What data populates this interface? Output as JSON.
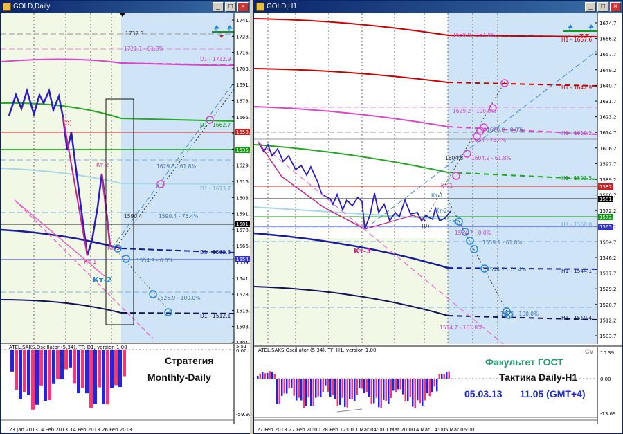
{
  "left_window": {
    "title": "GOLD,Daily",
    "buttons": {
      "minimize": "_",
      "maximize": "□",
      "close": "×"
    },
    "price_axis": [
      "1741.2",
      "1728.7",
      "1716.2",
      "1703.7",
      "1691.2",
      "1678.7",
      "1666.2",
      "1653.7",
      "1641.2",
      "1629.6",
      "1616.2",
      "1603.7",
      "1591.2",
      "1578.7",
      "1566.2",
      "1554.9",
      "1541.2",
      "1528.7",
      "1516.2",
      "1503.7",
      "1491.2"
    ],
    "price_tags": {
      "red": "1653.5",
      "green": "1635.3",
      "black": "1581.5",
      "blue": "1554.9"
    },
    "labels": {
      "lbl_1732": "1732.3",
      "lbl_1721": "1721.1 - 61.8%",
      "lbl_d1_1712": "D1 - 1712.9",
      "lbl_d1_1662": "D1 - 1662.7",
      "lbl_1629": "1629.6 - 61.8%",
      "lbl_d1_1613": "D1 - 1613.7",
      "lbl_1590": "1590.4",
      "lbl_1590_76": "1590.4 - 76.4%",
      "lbl_d1_1562": "D1 - 1562.3",
      "lbl_1554": "1554.9 - 0.0%",
      "lbl_1526": "1526.9 - 100.0%",
      "lbl_d1_1512": "D1 - 1512.1",
      "lbl_zero": "(0)",
      "lbl_kt2_top": "Кт-2",
      "lbl_kt1": "Кт-1",
      "lbl_kt3": "Кт-3",
      "lbl_kt2_blue": "Кт-2"
    },
    "osc_title": "ATEL.SAKS.Oscillator (5,34), TF: D1, version 1.00",
    "osc_axis": [
      "5.51",
      "0.00",
      "-59.93"
    ],
    "caption": [
      "Стратегия",
      "Monthly-Daily"
    ],
    "time_axis": [
      "23 Jan 2013",
      "4 Feb 2013",
      "14 Feb 2013",
      "26 Feb 2013"
    ]
  },
  "right_window": {
    "title": "GOLD,H1",
    "buttons": {
      "minimize": "_",
      "maximize": "□",
      "close": "×"
    },
    "price_axis": [
      "1674.7",
      "1666.2",
      "1657.7",
      "1649.2",
      "1640.7",
      "1631.7",
      "1623.2",
      "1614.7",
      "1606.2",
      "1597.7",
      "1589.2",
      "1580.7",
      "1572.2",
      "1563.2",
      "1554.7",
      "1546.2",
      "1537.7",
      "1529.2",
      "1520.7",
      "1512.2",
      "1503.7"
    ],
    "price_tags": {
      "red": "1587.2",
      "black": "1581.5",
      "green": "1572.6",
      "blue": "1565.6"
    },
    "labels": {
      "lbl_1668": "1668.9 - 161.8%",
      "lbl_h1_1667": "H1 - 1667.6",
      "lbl_h1_1642": "H1 - 1642.9",
      "lbl_1629": "1629.2 - 100.0%",
      "lbl_1620": "1620.0 - 0.0%",
      "lbl_h1_1618": "H1 - 1618.2",
      "lbl_1614": "1614 - 76.4%",
      "lbl_1604": "1604.9 - 61.8%",
      "lbl_1604b": "1604.8",
      "lbl_h1_1593": "H1 - 1593.5",
      "lbl_kt1": "Кт-1",
      "lbl_kt1b": "Кт-1",
      "lbl_kt2": "Кт-2",
      "lbl_zero": "(0)",
      "lbl_157": "157",
      "lbl_h1_1568": "H1 - 1568.8",
      "lbl_1564": "1564.7 - 0.0%",
      "lbl_1559": "1559.1 - 61.8%",
      "lbl_kt3": "Кт-3",
      "lbl_1544": "1544.7 - 76.4%",
      "lbl_h1_1544": "H1 - 1544.1",
      "lbl_1523": "1523 - 100.0%",
      "lbl_h1_1519": "H1 - 1519.4",
      "lbl_1514": "1514.7 - 161.8%"
    },
    "osc_title": "ATEL.SAKS.Oscillator (5,34), TF: H1, version 1.00",
    "osc_axis": [
      "10.39",
      "0.00",
      "-13.69"
    ],
    "caption": {
      "cv": "CV",
      "school": "Факультет ГОСТ",
      "tactic": "Тактика Daily-H1",
      "date": "05.03.13",
      "time": "11.05 (GMT+4)"
    },
    "time_axis": [
      "27 Feb 2013",
      "27 Feb 20:00",
      "28 Feb 12:00",
      "1 Mar 04:00",
      "1 Mar 20:00",
      "4 Mar 14:00",
      "5 Mar 06:00"
    ]
  },
  "colors": {
    "window_title": "#0a246a",
    "day_zone": "#f2f8e6",
    "future_zone": "#cfe4f6",
    "price_line": "#2a1cc4",
    "red_line": "#cc0000",
    "magenta": "#dd44cc",
    "green": "#22a822",
    "navy": "#1a1a8c",
    "osc_blue": "#2222ee",
    "osc_pink": "#ff3377",
    "caption_green": "#1f9a6a",
    "caption_blue": "#1a2ac8"
  }
}
